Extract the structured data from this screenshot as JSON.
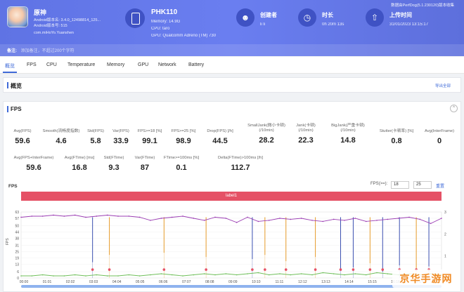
{
  "app": {
    "name": "原神",
    "android_line1": "Android版本名: 3.4.0_12498814_125...",
    "android_line2": "Android版本号: 515",
    "package": "com.miHoYo.Yuanshen"
  },
  "device": {
    "model": "PHK110",
    "memory": "Memory: 14.9G",
    "cpu": "CPU: taro",
    "gpu": "GPU: Qualcomm Adreno (TM) 730"
  },
  "creator": {
    "label": "创建者",
    "value": "li li"
  },
  "duration": {
    "label": "时长",
    "value": "0h 20m 13s"
  },
  "upload": {
    "label": "上传时间",
    "value": "31/01/2023 13:15:17"
  },
  "version": "数据由PerfDog(5.1.230120)版本收集",
  "remark": {
    "label": "备注:",
    "placeholder": "添加备注，不超过200个字符"
  },
  "tabs": [
    "概览",
    "FPS",
    "CPU",
    "Temperature",
    "Memory",
    "GPU",
    "Network",
    "Battery"
  ],
  "overview": {
    "title": "概览",
    "export": "导出全部"
  },
  "fps_card": {
    "title": "FPS",
    "collapse": "^",
    "row1": [
      {
        "label": "Avg(FPS)",
        "value": "59.6"
      },
      {
        "label": "Smooth(流畅度指数)",
        "value": "4.6"
      },
      {
        "label": "Std(FPS)",
        "value": "5.8"
      },
      {
        "label": "Var(FPS)",
        "value": "33.9"
      },
      {
        "label": "FPS>=18 [%]",
        "value": "99.1"
      },
      {
        "label": "FPS>=25 [%]",
        "value": "98.9"
      },
      {
        "label": "Drop(FPS) [/h]",
        "value": "44.5"
      },
      {
        "label": "SmallJank(微小卡顿)",
        "label2": "(/10min)",
        "value": "28.2"
      },
      {
        "label": "Jank(卡顿)",
        "label2": "(/10min)",
        "value": "22.3"
      },
      {
        "label": "BigJank(严重卡顿)",
        "label2": "(/10min)",
        "value": "14.8"
      },
      {
        "label": "Stutter(卡顿率) [%]",
        "value": "0.8"
      },
      {
        "label": "Avg(InterFrame)",
        "value": "0"
      }
    ],
    "row2": [
      {
        "label": "Avg(FPS+InterFrame)",
        "value": "59.6"
      },
      {
        "label": "Avg(FTime) [ms]",
        "value": "16.8"
      },
      {
        "label": "Std(FTime)",
        "value": "9.3"
      },
      {
        "label": "Var(FTime)",
        "value": "87"
      },
      {
        "label": "FTime>=100ms [%]",
        "value": "0.1"
      },
      {
        "label": "Delta(FTime)>100ms [/h]",
        "value": "112.7"
      }
    ]
  },
  "chart_header": {
    "title": "FPS",
    "fps_label": "FPS(>=):",
    "fps_a": "18",
    "fps_b": "25",
    "reset": "重置",
    "label_bar": "label1"
  },
  "chart_data": {
    "type": "line",
    "ylabel_left": "FPS",
    "y_ticks_left": [
      0,
      6,
      13,
      19,
      25,
      31,
      38,
      44,
      50,
      57,
      63
    ],
    "y_ticks_right": [
      0,
      1,
      2,
      3
    ],
    "ylim": [
      0,
      63
    ],
    "x_ticks": [
      "00:00",
      "01:01",
      "02:02",
      "03:03",
      "04:04",
      "05:05",
      "06:06",
      "07:07",
      "08:08",
      "09:09",
      "10:10",
      "11:11",
      "12:12",
      "13:13",
      "14:14",
      "15:15",
      "16:16",
      "17:17"
    ],
    "series": [
      {
        "color": "#9b3db3",
        "values": [
          58,
          59,
          59,
          60,
          59,
          60,
          58,
          59,
          60,
          59,
          59,
          58,
          55,
          57,
          58,
          59,
          57,
          55,
          58,
          57,
          53,
          58,
          54,
          55,
          57,
          56,
          57,
          55,
          54,
          56,
          55,
          57,
          54,
          55,
          56,
          57,
          58,
          56,
          52,
          57
        ]
      },
      {
        "color": "#6fbf5a",
        "values": [
          2,
          2,
          3,
          2,
          2,
          3,
          2,
          3,
          2,
          2,
          3,
          2,
          3,
          4,
          3,
          2,
          3,
          4,
          3,
          4,
          3,
          4,
          5,
          3,
          4,
          3,
          4,
          3,
          5,
          4,
          3,
          4,
          3,
          5,
          4,
          3,
          4,
          3,
          4,
          3
        ]
      }
    ],
    "spikes": [
      {
        "pos": 0.17,
        "color": "#3a4fb0",
        "low": 15
      },
      {
        "pos": 0.21,
        "color": "#e69b2a",
        "low": 22
      },
      {
        "pos": 0.34,
        "color": "#e69b2a",
        "low": 24
      },
      {
        "pos": 0.44,
        "color": "#e69b2a",
        "low": 20
      },
      {
        "pos": 0.55,
        "color": "#3a4fb0",
        "low": 18
      },
      {
        "pos": 0.58,
        "color": "#e69b2a",
        "low": 22
      },
      {
        "pos": 0.63,
        "color": "#e69b2a",
        "low": 16
      },
      {
        "pos": 0.7,
        "color": "#e69b2a",
        "low": 20
      },
      {
        "pos": 0.76,
        "color": "#3a4fb0",
        "low": 8
      },
      {
        "pos": 0.79,
        "color": "#3a4fb0",
        "low": 10
      },
      {
        "pos": 0.83,
        "color": "#e69b2a",
        "low": 14
      },
      {
        "pos": 0.86,
        "color": "#3a4fb0",
        "low": 6
      },
      {
        "pos": 0.9,
        "color": "#3a4fb0",
        "low": 12
      },
      {
        "pos": 0.94,
        "color": "#e69b2a",
        "low": 9
      },
      {
        "pos": 0.97,
        "color": "#3a4fb0",
        "low": 11
      }
    ]
  },
  "watermark": "京华手游网"
}
